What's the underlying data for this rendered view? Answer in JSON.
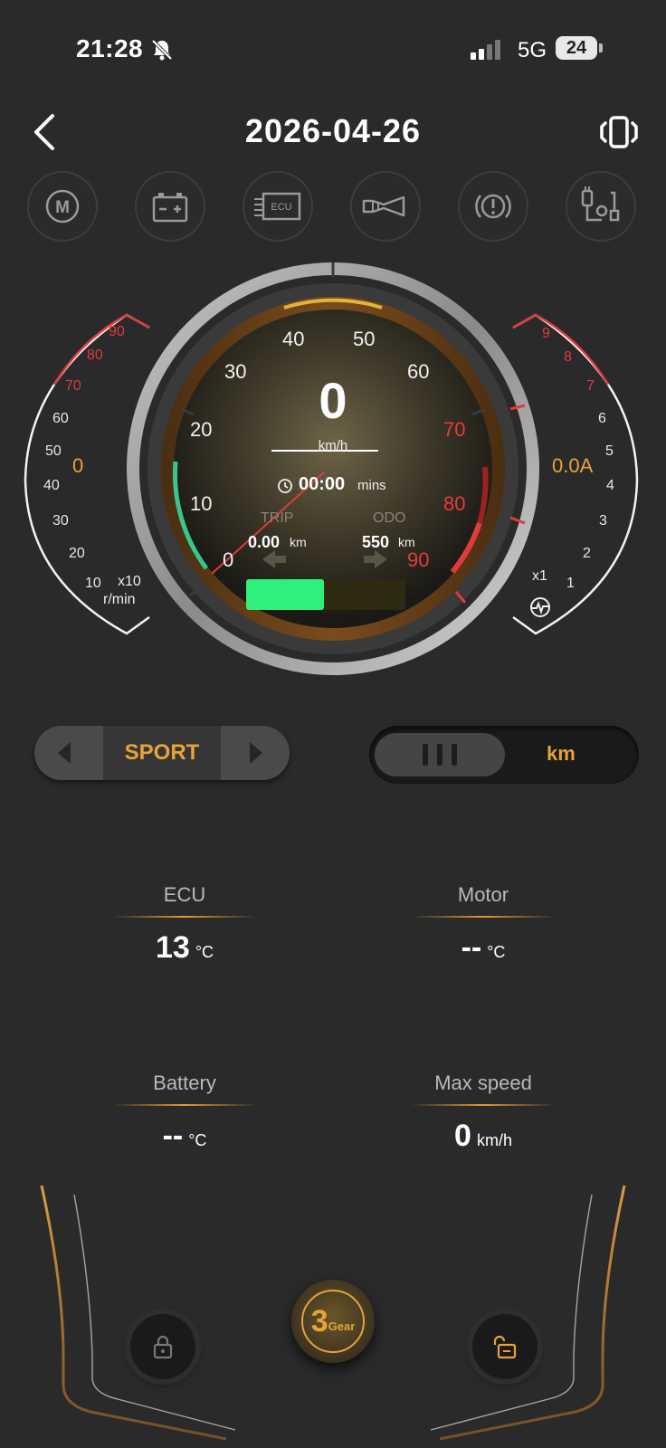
{
  "status": {
    "time": "21:28",
    "network": "5G",
    "battery": "24"
  },
  "header": {
    "title": "2026-04-26"
  },
  "tool_icons": [
    "m-icon",
    "battery-icon",
    "ecu-icon",
    "horn-icon",
    "warning-icon",
    "charger-icon"
  ],
  "ecu_icon_text": "ECU",
  "rpm_gauge": {
    "ticks": [
      "10",
      "20",
      "30",
      "40",
      "50",
      "60",
      "70",
      "80",
      "90"
    ],
    "value": "0",
    "multiplier": "x10",
    "unit": "r/min"
  },
  "current_gauge": {
    "ticks": [
      "1",
      "2",
      "3",
      "4",
      "5",
      "6",
      "7",
      "8",
      "9"
    ],
    "value": "0.0A",
    "multiplier": "x1"
  },
  "speedometer": {
    "ticks": [
      "0",
      "10",
      "20",
      "30",
      "40",
      "50",
      "60",
      "70",
      "80",
      "90"
    ],
    "speed": "0",
    "speed_unit": "km/h",
    "time": "00:00",
    "time_unit": "mins",
    "trip_label": "TRIP",
    "trip_value": "0.00",
    "trip_unit": "km",
    "odo_label": "ODO",
    "odo_value": "550",
    "odo_unit": "km",
    "battery_level": 0.49
  },
  "mode": {
    "label": "SPORT"
  },
  "unit_toggle": {
    "label": "km"
  },
  "stats": {
    "ecu": {
      "label": "ECU",
      "value": "13",
      "unit": "°C"
    },
    "motor": {
      "label": "Motor",
      "value": "--",
      "unit": "°C"
    },
    "battery": {
      "label": "Battery",
      "value": "--",
      "unit": "°C"
    },
    "max_speed": {
      "label": "Max speed",
      "value": "0",
      "unit": "km/h"
    }
  },
  "gear": {
    "number": "3",
    "label": "Gear"
  },
  "colors": {
    "accent": "#e7a23a",
    "red": "#e03b3b",
    "green": "#2ff07a"
  }
}
